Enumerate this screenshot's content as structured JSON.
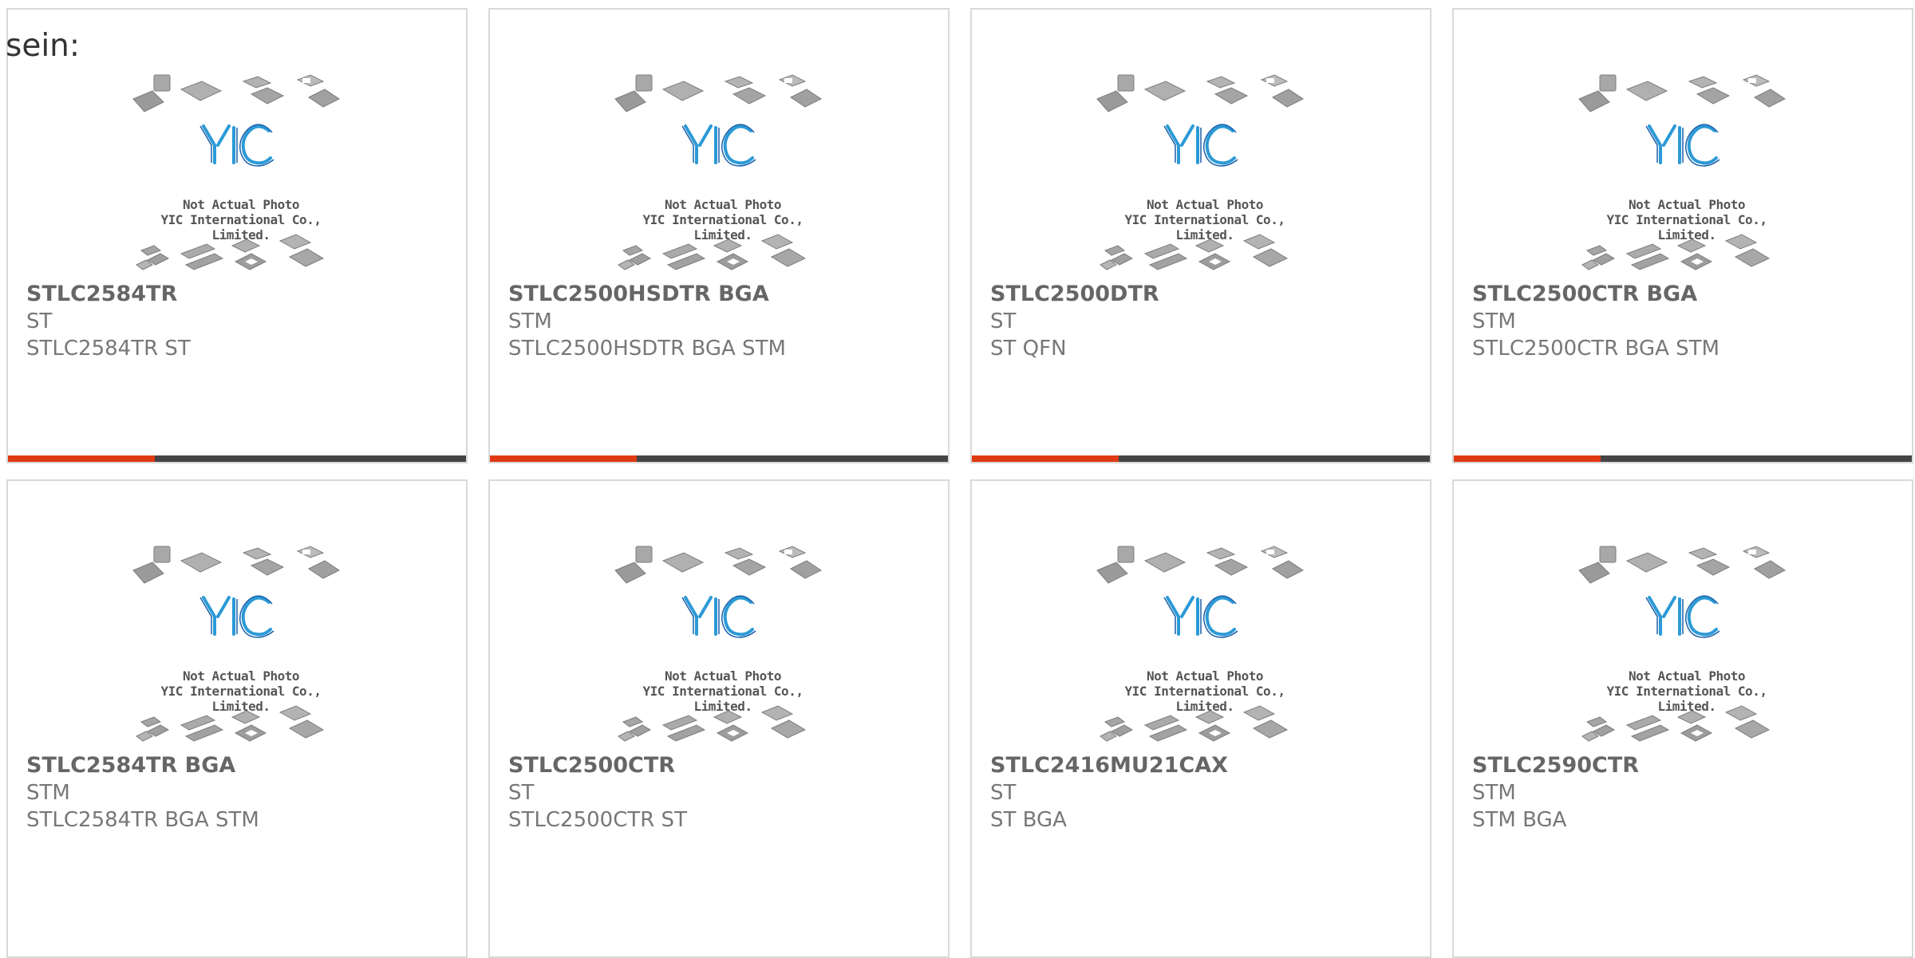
{
  "intro_text": "sein:",
  "photo_caption": {
    "line1": "Not Actual Photo",
    "line2": "YIC International Co., Limited."
  },
  "logo_text": "YIC",
  "colors": {
    "accent": "#e03a12",
    "bar_track": "#444444",
    "logo_blue": "#2b9ad6"
  },
  "products": [
    {
      "part": "STLC2584TR",
      "brand": "ST",
      "desc": "STLC2584TR ST",
      "progress": 0.32
    },
    {
      "part": "STLC2500HSDTR BGA",
      "brand": "STM",
      "desc": "STLC2500HSDTR BGA STM",
      "progress": 0.32
    },
    {
      "part": "STLC2500DTR",
      "brand": "ST",
      "desc": "ST QFN",
      "progress": 0.32
    },
    {
      "part": "STLC2500CTR BGA",
      "brand": "STM",
      "desc": "STLC2500CTR BGA STM",
      "progress": 0.32
    },
    {
      "part": "STLC2584TR BGA",
      "brand": "STM",
      "desc": "STLC2584TR BGA STM"
    },
    {
      "part": "STLC2500CTR",
      "brand": "ST",
      "desc": "STLC2500CTR ST"
    },
    {
      "part": "STLC2416MU21CAX",
      "brand": "ST",
      "desc": "ST BGA"
    },
    {
      "part": "STLC2590CTR",
      "brand": "STM",
      "desc": "STM BGA"
    }
  ]
}
